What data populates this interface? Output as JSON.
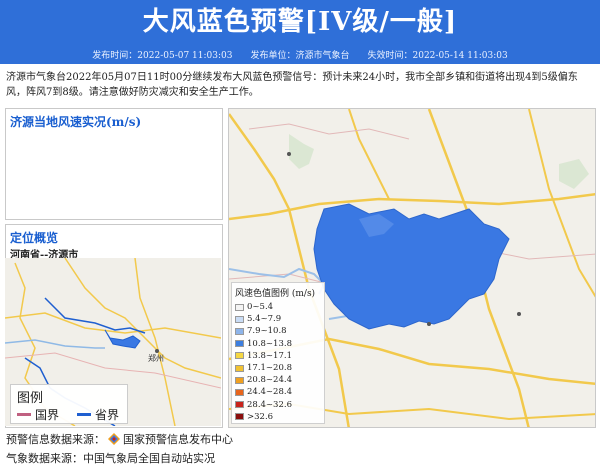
{
  "header": {
    "title": "大风蓝色预警[IV级/一般]",
    "issue_time": "发布时间：2022-05-07 11:03:03",
    "issuer": "发布单位：济源市气象台",
    "expire_time": "失效时间：2022-05-14 11:03:03"
  },
  "summary": "济源市气象台2022年05月07日11时00分继续发布大风蓝色预警信号：预计未来24小时，我市全部乡镇和街道将出现4到5级偏东风，阵风7到8级。请注意做好防灾减灾和安全生产工作。",
  "wind_panel": {
    "title": "济源当地风速实况(m/s)"
  },
  "location_panel": {
    "title": "定位概览",
    "location": "河南省--济源市"
  },
  "mini_map": {
    "city_label": "郑州",
    "legend_title": "图例",
    "legend_items": [
      {
        "label": "国界",
        "color": "#c06080"
      },
      {
        "label": "省界",
        "color": "#1f5fd0"
      }
    ]
  },
  "wind_legend": {
    "title": "风速色值图例 (m/s)",
    "items": [
      {
        "label": "0~5.4",
        "color": "#f4f4f4"
      },
      {
        "label": "5.4~7.9",
        "color": "#c9dcf5"
      },
      {
        "label": "7.9~10.8",
        "color": "#8db4ea"
      },
      {
        "label": "10.8~13.8",
        "color": "#3d7fe0"
      },
      {
        "label": "13.8~17.1",
        "color": "#f5d742"
      },
      {
        "label": "17.1~20.8",
        "color": "#f1c232"
      },
      {
        "label": "20.8~24.4",
        "color": "#f0a020"
      },
      {
        "label": "24.4~28.4",
        "color": "#e8651c"
      },
      {
        "label": "28.4~32.6",
        "color": "#c9241b"
      },
      {
        "label": ">32.6",
        "color": "#8a0e0e"
      }
    ]
  },
  "footer": {
    "warning_source": "预警信息数据来源：",
    "warning_source_name": "国家预警信息发布中心",
    "weather_source": "气象数据来源：中国气象局全国自动站实况"
  },
  "colors": {
    "banner": "#2f6fd8",
    "accent": "#1a5fd0",
    "warning_area": "#3a78e3"
  }
}
